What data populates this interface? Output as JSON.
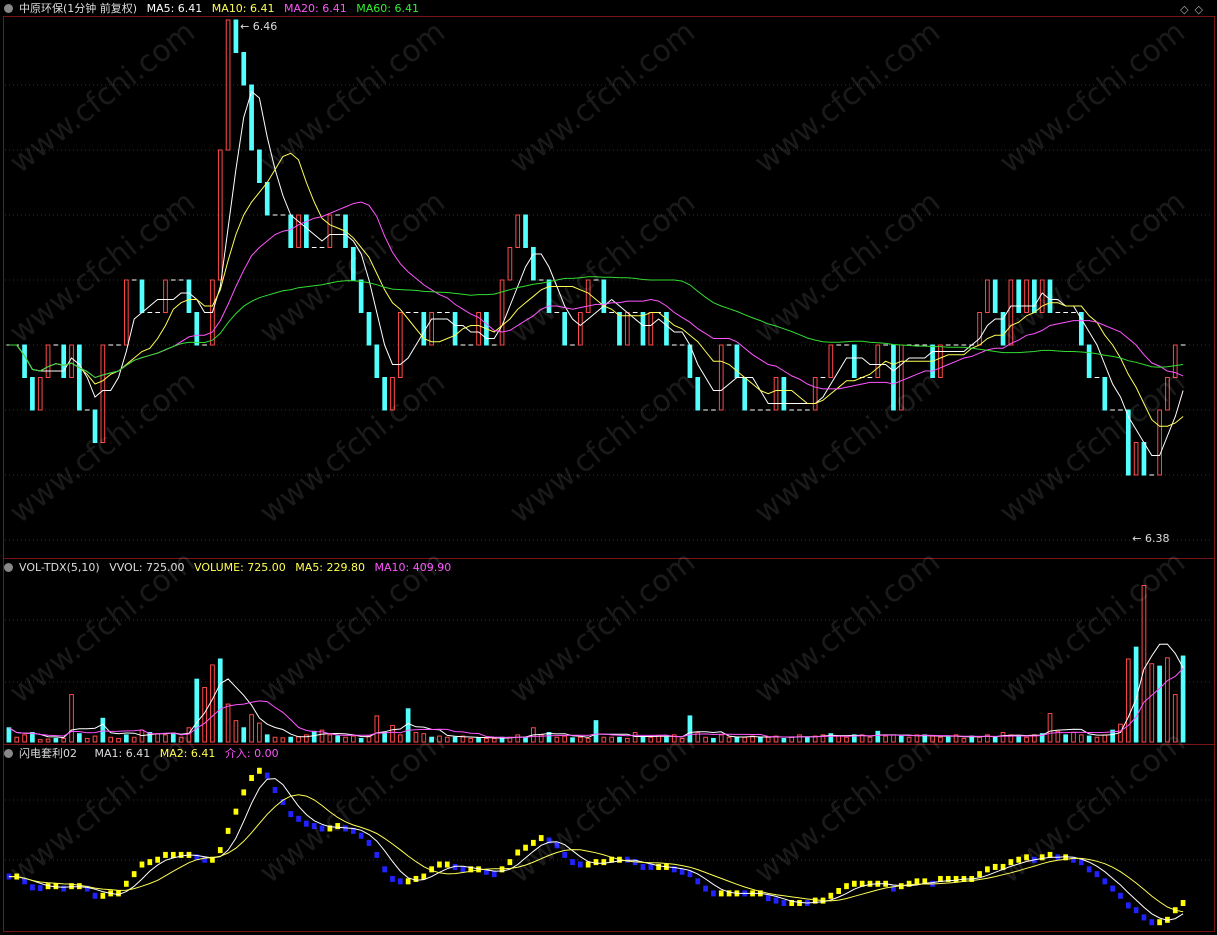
{
  "price_panel": {
    "header": {
      "stock": "中原环保(1分钟 前复权)",
      "ma5": "MA5: 6.41",
      "ma10": "MA10: 6.41",
      "ma20": "MA20: 6.41",
      "ma60": "MA60: 6.41"
    },
    "high_label": "6.46",
    "low_label": "6.38"
  },
  "volume_panel": {
    "header": {
      "name": "VOL-TDX(5,10)",
      "vvol": "VVOL: 725.00",
      "volume": "VOLUME: 725.00",
      "ma5": "MA5: 229.80",
      "ma10": "MA10: 409.90"
    }
  },
  "indicator_panel": {
    "header": {
      "name": "闪电套利02",
      "ma1": "MA1: 6.41",
      "ma2": "MA2: 6.41",
      "entry": "介入: 0.00"
    }
  },
  "watermark": "www.cfchi.com",
  "top_right_icons": [
    "diamond-icon",
    "diamond-icon"
  ],
  "colors": {
    "up": "#ff4a4a",
    "down": "#54ffff",
    "ma5": "#ffffff",
    "ma10": "#ffff55",
    "ma20": "#ff55ff",
    "ma60": "#33dd33",
    "grid": "#7a1515"
  },
  "chart_data": [
    {
      "type": "candlestick",
      "title": "中原环保(1分钟 前复权)",
      "ylim": [
        6.38,
        6.46
      ],
      "annotations": [
        "6.46",
        "6.38"
      ],
      "series": [
        {
          "name": "MA5",
          "last": 6.41
        },
        {
          "name": "MA10",
          "last": 6.41
        },
        {
          "name": "MA20",
          "last": 6.41
        },
        {
          "name": "MA60",
          "last": 6.41
        }
      ],
      "close": [
        6.41,
        6.41,
        6.405,
        6.4,
        6.405,
        6.41,
        6.41,
        6.405,
        6.41,
        6.4,
        6.4,
        6.395,
        6.41,
        6.41,
        6.41,
        6.42,
        6.42,
        6.415,
        6.415,
        6.415,
        6.42,
        6.42,
        6.42,
        6.415,
        6.41,
        6.41,
        6.42,
        6.44,
        6.46,
        6.455,
        6.45,
        6.44,
        6.435,
        6.43,
        6.43,
        6.43,
        6.425,
        6.43,
        6.425,
        6.425,
        6.425,
        6.43,
        6.43,
        6.425,
        6.42,
        6.415,
        6.41,
        6.405,
        6.4,
        6.405,
        6.415,
        6.415,
        6.415,
        6.41,
        6.415,
        6.415,
        6.415,
        6.41,
        6.41,
        6.41,
        6.415,
        6.41,
        6.41,
        6.42,
        6.425,
        6.43,
        6.425,
        6.42,
        6.42,
        6.415,
        6.415,
        6.41,
        6.41,
        6.415,
        6.42,
        6.42,
        6.415,
        6.415,
        6.41,
        6.415,
        6.415,
        6.41,
        6.415,
        6.415,
        6.41,
        6.41,
        6.41,
        6.405,
        6.4,
        6.4,
        6.4,
        6.41,
        6.41,
        6.405,
        6.4,
        6.4,
        6.4,
        6.4,
        6.405,
        6.4,
        6.4,
        6.4,
        6.4,
        6.405,
        6.405,
        6.41,
        6.41,
        6.41,
        6.405,
        6.405,
        6.405,
        6.41,
        6.41,
        6.4,
        6.41,
        6.41,
        6.41,
        6.41,
        6.405,
        6.41,
        6.41,
        6.41,
        6.41,
        6.41,
        6.415,
        6.42,
        6.415,
        6.41,
        6.42,
        6.415,
        6.42,
        6.415,
        6.42,
        6.415,
        6.415,
        6.415,
        6.415,
        6.41,
        6.405,
        6.405,
        6.4,
        6.4,
        6.4,
        6.39,
        6.395,
        6.39,
        6.39,
        6.4,
        6.405,
        6.41,
        6.41
      ]
    },
    {
      "type": "bar",
      "title": "VOL-TDX(5,10)",
      "series": [
        {
          "name": "VVOL",
          "last": 725.0
        },
        {
          "name": "VOLUME",
          "last": 725.0
        },
        {
          "name": "MA5",
          "last": 229.8
        },
        {
          "name": "MA10",
          "last": 409.9
        }
      ],
      "values": [
        120,
        40,
        60,
        80,
        20,
        25,
        30,
        30,
        400,
        70,
        30,
        50,
        200,
        40,
        30,
        60,
        40,
        100,
        80,
        70,
        60,
        75,
        40,
        120,
        530,
        460,
        650,
        700,
        320,
        180,
        120,
        230,
        160,
        60,
        40,
        35,
        40,
        45,
        60,
        90,
        100,
        60,
        50,
        40,
        50,
        30,
        50,
        220,
        80,
        140,
        60,
        280,
        80,
        70,
        40,
        50,
        40,
        40,
        50,
        30,
        35,
        30,
        30,
        40,
        40,
        60,
        40,
        120,
        60,
        80,
        40,
        50,
        35,
        40,
        30,
        180,
        40,
        40,
        40,
        30,
        80,
        40,
        40,
        50,
        40,
        60,
        30,
        220,
        80,
        40,
        30,
        60,
        40,
        40,
        40,
        50,
        40,
        40,
        50,
        30,
        40,
        60,
        40,
        50,
        60,
        70,
        50,
        40,
        60,
        60,
        40,
        90,
        50,
        60,
        50,
        40,
        60,
        60,
        50,
        40,
        40,
        60,
        30,
        50,
        40,
        60,
        40,
        80,
        60,
        50,
        40,
        60,
        70,
        240,
        90,
        60,
        80,
        60,
        50,
        40,
        60,
        100,
        150,
        700,
        800,
        1320,
        660,
        640,
        710,
        400,
        725
      ]
    },
    {
      "type": "line",
      "title": "闪电套利02",
      "series": [
        {
          "name": "MA1",
          "last": 6.41
        },
        {
          "name": "MA2",
          "last": 6.41
        },
        {
          "name": "介入",
          "last": 0.0
        }
      ]
    }
  ]
}
